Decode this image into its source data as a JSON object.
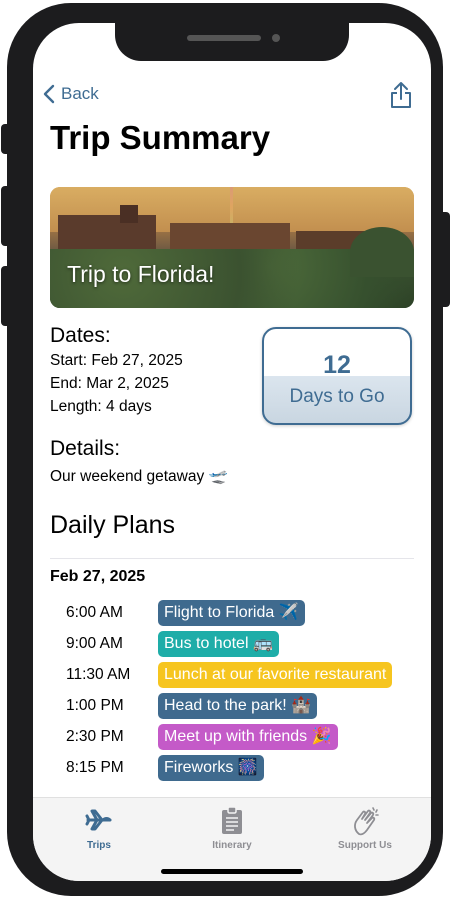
{
  "nav": {
    "back_label": "Back"
  },
  "page_title": "Trip Summary",
  "hero": {
    "caption": "Trip to Florida!"
  },
  "dates": {
    "heading": "Dates:",
    "start": "Start: Feb 27, 2025",
    "end": "End: Mar 2, 2025",
    "length": "Length: 4 days"
  },
  "countdown": {
    "number": "12",
    "label": "Days to Go"
  },
  "details": {
    "heading": "Details:",
    "text": "Our weekend getaway 🛫"
  },
  "daily_plans": {
    "heading": "Daily Plans",
    "day_date": "Feb 27, 2025",
    "items": [
      {
        "time": "6:00 AM",
        "label": "Flight to Florida ✈️",
        "color": "#3f6a8e"
      },
      {
        "time": "9:00 AM",
        "label": "Bus to hotel 🚌",
        "color": "#1eada8"
      },
      {
        "time": "11:30 AM",
        "label": "Lunch at our favorite restaurant",
        "color": "#f6c51f"
      },
      {
        "time": "1:00 PM",
        "label": "Head to the park! 🏰",
        "color": "#3f6a8e"
      },
      {
        "time": "2:30 PM",
        "label": "Meet up with friends 🎉",
        "color": "#c45ac8"
      },
      {
        "time": "8:15 PM",
        "label": "Fireworks 🎆",
        "color": "#3f6a8e"
      }
    ]
  },
  "tabbar": {
    "tabs": [
      {
        "label": "Trips",
        "icon": "airplane-icon",
        "active": true
      },
      {
        "label": "Itinerary",
        "icon": "clipboard-icon",
        "active": false
      },
      {
        "label": "Support Us",
        "icon": "clapping-hands-icon",
        "active": false
      }
    ]
  },
  "colors": {
    "accent": "#3f6c92",
    "inactive": "#8e8e93"
  }
}
